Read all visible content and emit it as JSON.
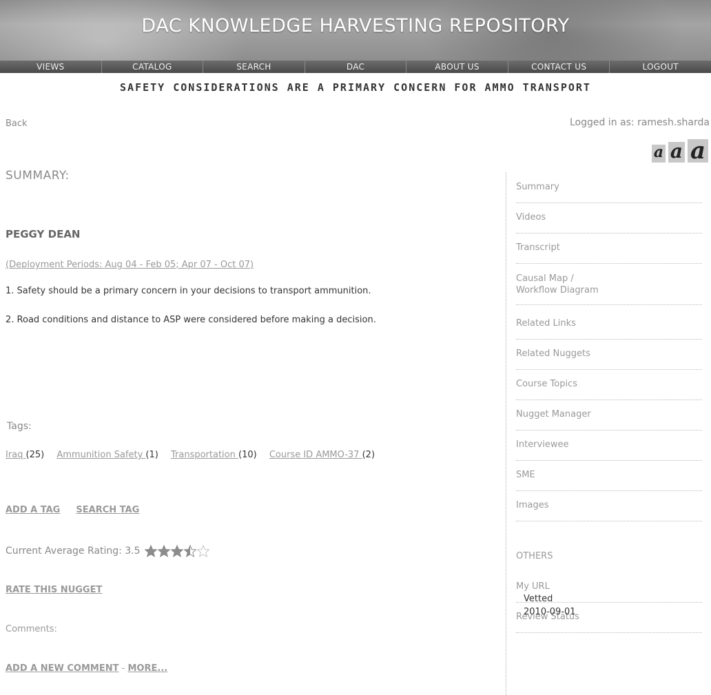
{
  "banner": {
    "title": "DAC KNOWLEDGE HARVESTING REPOSITORY"
  },
  "nav": {
    "items": [
      "VIEWS",
      "CATALOG",
      "SEARCH",
      "DAC",
      "ABOUT US",
      "CONTACT US",
      "LOGOUT"
    ]
  },
  "nugget": {
    "title": "SAFETY CONSIDERATIONS ARE A PRIMARY CONCERN FOR AMMO TRANSPORT"
  },
  "top": {
    "back_label": "Back",
    "logged_in": "Logged in as: ramesh.sharda",
    "font_sizes": [
      "a",
      "a",
      "a"
    ]
  },
  "main": {
    "summary_heading": "SUMMARY:",
    "person": "PEGGY DEAN",
    "deployment": "(Deployment Periods: Aug 04 - Feb 05; Apr 07 - Oct 07)",
    "points": [
      "1. Safety should be a primary concern in your decisions to transport ammunition.",
      "2. Road conditions and distance to ASP were considered before making a decision."
    ],
    "tags_heading": "Tags:",
    "tags": [
      {
        "label": "Iraq ",
        "count": "(25)"
      },
      {
        "label": "Ammunition Safety ",
        "count": "(1)"
      },
      {
        "label": "Transportation ",
        "count": "(10)"
      },
      {
        "label": "Course ID AMMO-37 ",
        "count": "(2)"
      }
    ],
    "add_tag": "ADD A TAG",
    "search_tag": "SEARCH TAG",
    "rating_label": "Current Average Rating: 3.5",
    "rating_value": 3.5,
    "rating_max": 5,
    "rate_link": "RATE THIS NUGGET",
    "comments_heading": "Comments:",
    "add_comment": "ADD A NEW COMMENT",
    "comment_sep": " - ",
    "more": "MORE..."
  },
  "sidebar": {
    "items": [
      [
        "Summary"
      ],
      [
        "Videos"
      ],
      [
        "Transcript"
      ],
      [
        "Causal Map /",
        "Workflow Diagram"
      ],
      [
        "Related Links"
      ],
      [
        "Related Nuggets"
      ],
      [
        "Course Topics"
      ],
      [
        "Nugget Manager"
      ],
      [
        "Interviewee"
      ],
      [
        "SME"
      ],
      [
        "Images"
      ]
    ],
    "others_heading": "OTHERS",
    "others_items": [
      [
        "My URL"
      ],
      [
        "Review Status"
      ]
    ],
    "status": "Vetted",
    "status_date": "2010-09-01"
  },
  "colors": {
    "star_filled": "#8c8c8c",
    "star_empty": "#c4c4c4"
  }
}
